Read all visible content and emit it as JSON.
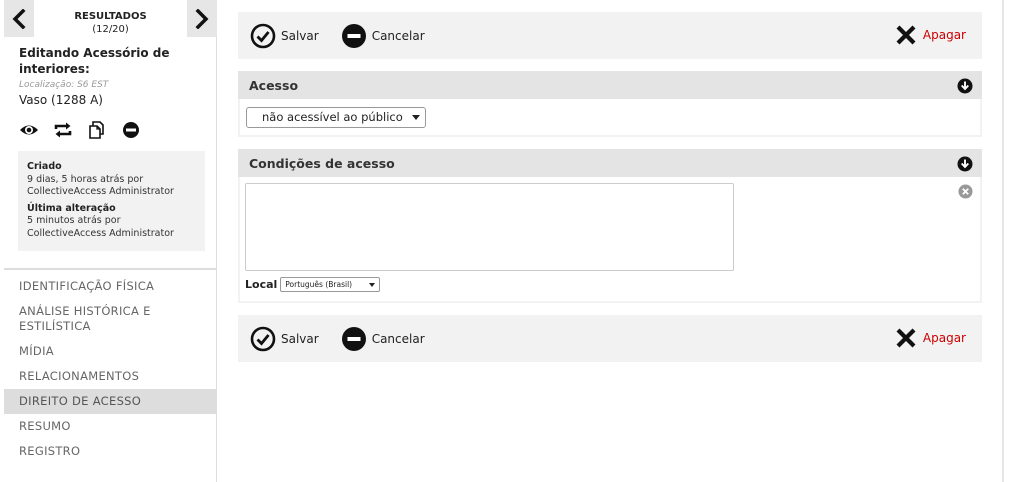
{
  "results_nav": {
    "title": "RESULTADOS",
    "count": "(12/20)"
  },
  "record": {
    "editing_label": "Editando Acessório de interiores:",
    "location": "Localização: S6 EST",
    "name": "Vaso (1288 A)"
  },
  "record_actions": [
    {
      "icon": "eye-icon"
    },
    {
      "icon": "swap-icon"
    },
    {
      "icon": "duplicate-icon"
    },
    {
      "icon": "remove-icon"
    }
  ],
  "meta": {
    "created_label": "Criado",
    "created_value": "9 dias, 5 horas atrás por CollectiveAccess Administrator",
    "modified_label": "Última alteração",
    "modified_value": "5 minutos atrás por CollectiveAccess Administrator"
  },
  "sidebar_nav": [
    {
      "label": "IDENTIFICAÇÃO FÍSICA",
      "active": false
    },
    {
      "label": "ANÁLISE HISTÓRICA E ESTILÍSTICA",
      "active": false
    },
    {
      "label": "MÍDIA",
      "active": false
    },
    {
      "label": "RELACIONAMENTOS",
      "active": false
    },
    {
      "label": "DIREITO DE ACESSO",
      "active": true
    },
    {
      "label": "RESUMO",
      "active": false
    },
    {
      "label": "REGISTRO",
      "active": false
    }
  ],
  "controls": {
    "save_label": "Salvar",
    "cancel_label": "Cancelar",
    "delete_label": "Apagar"
  },
  "access": {
    "title": "Acesso",
    "selected": "não acessível ao público"
  },
  "conditions": {
    "title": "Condições de acesso",
    "text": "",
    "locale_label": "Local",
    "locale_selected": "Português (Brasil)"
  },
  "colors": {
    "delete": "#cc0000",
    "panel_bg": "#f2f2f2",
    "header_bg": "#e4e4e4",
    "active_nav": "#dddddd"
  }
}
